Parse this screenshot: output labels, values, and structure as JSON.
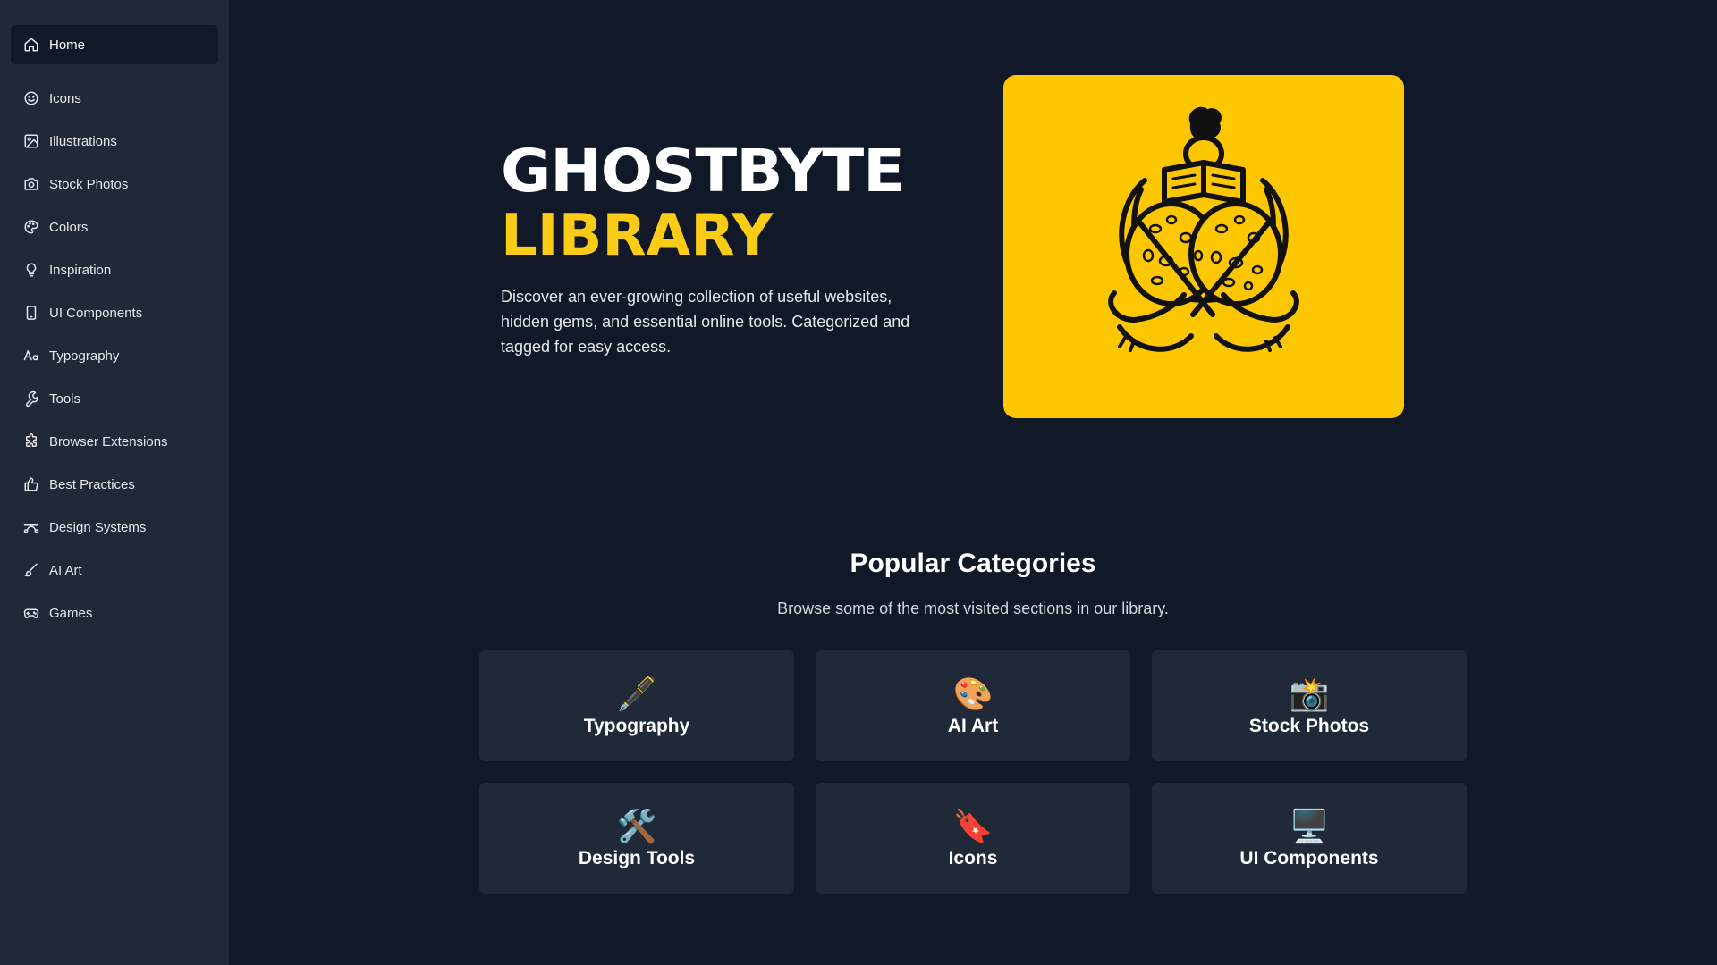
{
  "sidebar": {
    "items": [
      {
        "label": "Home",
        "icon": "home-icon",
        "active": true
      },
      {
        "label": "Icons",
        "icon": "smiley-icon"
      },
      {
        "label": "Illustrations",
        "icon": "image-icon"
      },
      {
        "label": "Stock Photos",
        "icon": "camera-icon"
      },
      {
        "label": "Colors",
        "icon": "palette-icon"
      },
      {
        "label": "Inspiration",
        "icon": "lightbulb-icon"
      },
      {
        "label": "UI Components",
        "icon": "phone-icon"
      },
      {
        "label": "Typography",
        "icon": "text-icon"
      },
      {
        "label": "Tools",
        "icon": "wrench-icon"
      },
      {
        "label": "Browser Extensions",
        "icon": "puzzle-icon"
      },
      {
        "label": "Best Practices",
        "icon": "thumbs-up-icon"
      },
      {
        "label": "Design Systems",
        "icon": "bezier-icon"
      },
      {
        "label": "AI Art",
        "icon": "brush-icon"
      },
      {
        "label": "Games",
        "icon": "gamepad-icon"
      }
    ]
  },
  "hero": {
    "title_line1": "GHOSTBYTE",
    "title_line2": "LIBRARY",
    "description": "Discover an ever-growing collection of useful websites, hidden gems, and essential online tools. Categorized and tagged for easy access.",
    "image": "reading-person-illustration"
  },
  "categories": {
    "title": "Popular Categories",
    "subtitle": "Browse some of the most visited sections in our library.",
    "items": [
      {
        "emoji": "🖋️",
        "label": "Typography"
      },
      {
        "emoji": "🎨",
        "label": "AI Art"
      },
      {
        "emoji": "📸",
        "label": "Stock Photos"
      },
      {
        "emoji": "🛠️",
        "label": "Design Tools"
      },
      {
        "emoji": "🔖",
        "label": "Icons"
      },
      {
        "emoji": "🖥️",
        "label": "UI Components"
      }
    ]
  },
  "colors": {
    "background": "#111827",
    "sidebar": "#1f2937",
    "accent": "#facc15",
    "hero_bg": "#fcc700"
  }
}
